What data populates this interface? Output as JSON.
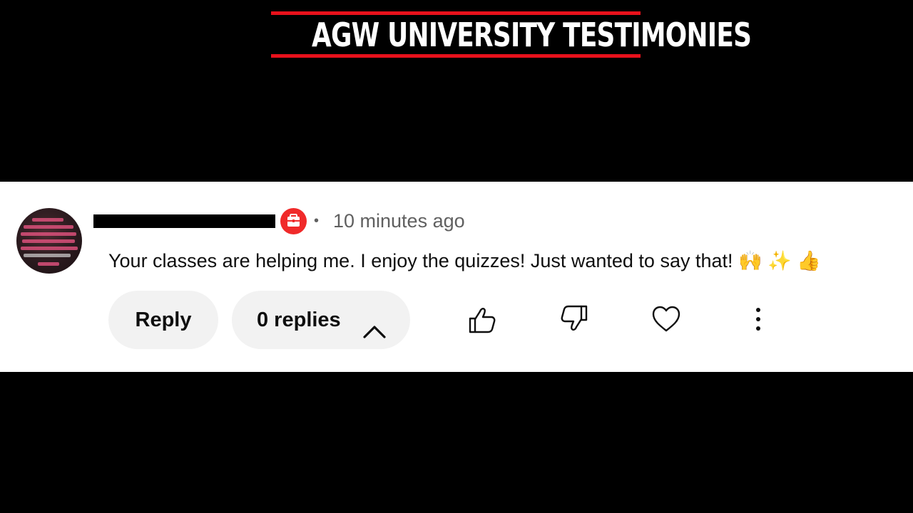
{
  "banner": {
    "title": "AGW UNIVERSITY TESTIMONIES",
    "accent_color": "#e8111b"
  },
  "comment": {
    "avatar_icon": "channel-avatar",
    "author_redacted": true,
    "badge_icon": "member-badge-icon",
    "separator": "•",
    "timestamp": "10 minutes ago",
    "text": "Your classes are helping me. I enjoy the quizzes! Just wanted to say that! 🙌 ✨ 👍"
  },
  "actions": {
    "reply_label": "Reply",
    "replies_label": "0 replies",
    "replies_icon": "chevron-up-icon",
    "like_icon": "thumbs-up-icon",
    "dislike_icon": "thumbs-down-icon",
    "heart_icon": "heart-icon",
    "more_icon": "more-vertical-icon"
  }
}
